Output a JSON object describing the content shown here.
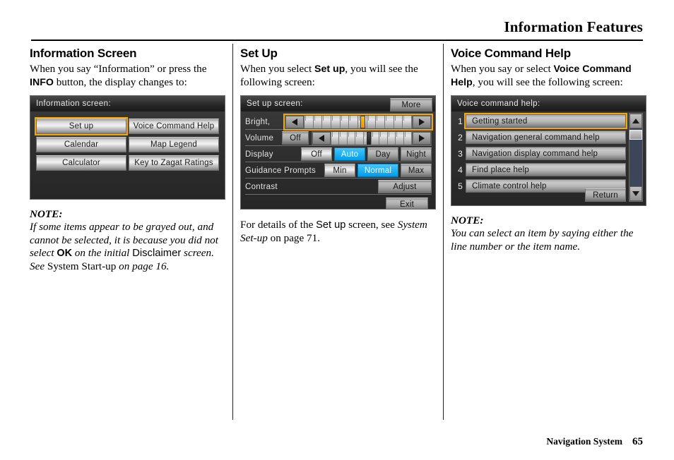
{
  "header": {
    "title": "Information Features"
  },
  "footer": {
    "book": "Navigation System",
    "page": "65"
  },
  "col1": {
    "heading": "Information Screen",
    "intro_a": "When you say “Information” or press the ",
    "intro_b": "INFO",
    "intro_c": " button, the display changes to:",
    "screen": {
      "title": "Information screen:",
      "buttons": [
        {
          "label": "Set up",
          "selected": true
        },
        {
          "label": "Voice Command Help",
          "selected": false
        },
        {
          "label": "Calendar",
          "selected": false
        },
        {
          "label": "Map Legend",
          "selected": false
        },
        {
          "label": "Calculator",
          "selected": false
        },
        {
          "label": "Key to Zagat Ratings",
          "selected": false
        }
      ]
    },
    "note_label": "NOTE:",
    "note_a": "If some items appear to be grayed out, and cannot be selected, it is because you did not select ",
    "note_ok": "OK",
    "note_b": " on the initial ",
    "note_disclaimer": "Disclaimer",
    "note_c": " screen. See ",
    "note_startup": "System Start-up",
    "note_d": " on page 16."
  },
  "col2": {
    "heading": "Set Up",
    "intro_a": "When you select ",
    "intro_b": "Set up",
    "intro_c": ", you will see the following screen:",
    "screen": {
      "title": "Set up screen:",
      "more_label": "More",
      "rows": {
        "bright": {
          "label": "Bright,"
        },
        "volume": {
          "label": "Volume",
          "off_label": "Off"
        },
        "display": {
          "label": "Display",
          "options": [
            "Off",
            "Auto",
            "Day",
            "Night"
          ],
          "selected": "Auto"
        },
        "guidance": {
          "label": "Guidance Prompts",
          "options": [
            "Min",
            "Normal",
            "Max"
          ],
          "selected": "Normal"
        },
        "contrast": {
          "label": "Contrast",
          "adjust_label": "Adjust"
        }
      },
      "exit_label": "Exit"
    },
    "after_a": "For details of the ",
    "after_b": "Set up",
    "after_c": " screen, see ",
    "after_d": "System Set-up",
    "after_e": " on page 71."
  },
  "col3": {
    "heading": "Voice Command Help",
    "intro_a": "When you say or select ",
    "intro_b": "Voice Command Help",
    "intro_c": ", you will see the following screen:",
    "screen": {
      "title": "Voice command help:",
      "items": [
        {
          "num": "1",
          "label": "Getting started",
          "selected": true
        },
        {
          "num": "2",
          "label": "Navigation general command help",
          "selected": false
        },
        {
          "num": "3",
          "label": "Navigation display command help",
          "selected": false
        },
        {
          "num": "4",
          "label": "Find place help",
          "selected": false
        },
        {
          "num": "5",
          "label": "Climate control help",
          "selected": false
        }
      ],
      "return_label": "Return"
    },
    "note_label": "NOTE:",
    "note_body": "You can select an item by saying either the line number or the item name."
  },
  "colors": {
    "highlight_orange": "#f5a800",
    "active_blue": "#29b6f6",
    "screen_dark": "#2b2b2b"
  }
}
